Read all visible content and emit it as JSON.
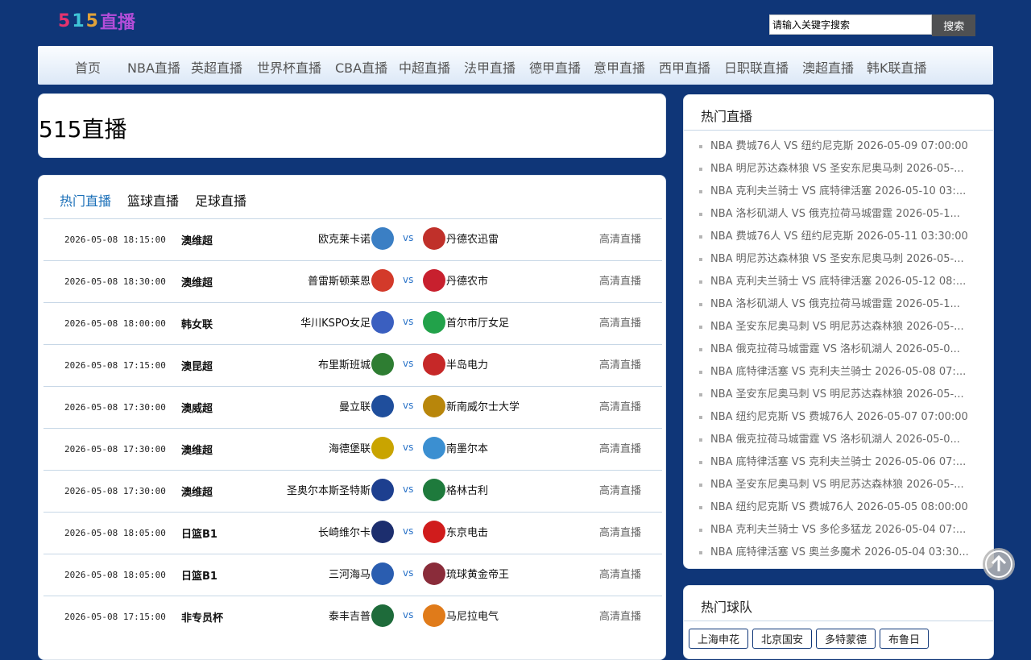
{
  "logo": {
    "text": "515直播"
  },
  "search": {
    "placeholder": "请输入关键字搜索",
    "button": "搜索"
  },
  "nav": [
    "首页",
    "NBA直播",
    "英超直播",
    "世界杯直播",
    "CBA直播",
    "中超直播",
    "法甲直播",
    "德甲直播",
    "意甲直播",
    "西甲直播",
    "日职联直播",
    "澳超直播",
    "韩K联直播"
  ],
  "site_title": "515直播",
  "tabs": [
    "热门直播",
    "篮球直播",
    "足球直播"
  ],
  "matches": [
    {
      "time": "2026-05-08 18:15:00",
      "league": "澳维超",
      "home": "欧克莱卡诺",
      "vs": "vs",
      "away": "丹德农迅雷",
      "watch": "高清直播",
      "home_color": "#3b7fc4",
      "away_color": "#c0302a"
    },
    {
      "time": "2026-05-08 18:30:00",
      "league": "澳维超",
      "home": "普雷斯顿莱恩",
      "vs": "vs",
      "away": "丹德农市",
      "watch": "高清直播",
      "home_color": "#d33a2a",
      "away_color": "#c8202e"
    },
    {
      "time": "2026-05-08 18:00:00",
      "league": "韩女联",
      "home": "华川KSPO女足",
      "vs": "vs",
      "away": "首尔市厅女足",
      "watch": "高清直播",
      "home_color": "#3a5fc0",
      "away_color": "#22a24a"
    },
    {
      "time": "2026-05-08 17:15:00",
      "league": "澳昆超",
      "home": "布里斯班城",
      "vs": "vs",
      "away": "半岛电力",
      "watch": "高清直播",
      "home_color": "#2e7d32",
      "away_color": "#c62828"
    },
    {
      "time": "2026-05-08 17:30:00",
      "league": "澳威超",
      "home": "曼立联",
      "vs": "vs",
      "away": "新南威尔士大学",
      "watch": "高清直播",
      "home_color": "#1f4e9c",
      "away_color": "#b8860b"
    },
    {
      "time": "2026-05-08 17:30:00",
      "league": "澳维超",
      "home": "海德堡联",
      "vs": "vs",
      "away": "南墨尔本",
      "watch": "高清直播",
      "home_color": "#c9a400",
      "away_color": "#3b8fd1"
    },
    {
      "time": "2026-05-08 17:30:00",
      "league": "澳维超",
      "home": "圣奥尔本斯圣特斯",
      "vs": "vs",
      "away": "格林古利",
      "watch": "高清直播",
      "home_color": "#1d3f8f",
      "away_color": "#1e7a3c"
    },
    {
      "time": "2026-05-08 18:05:00",
      "league": "日篮B1",
      "home": "长崎维尔卡",
      "vs": "vs",
      "away": "东京电击",
      "watch": "高清直播",
      "home_color": "#1c2e6e",
      "away_color": "#d01c1c"
    },
    {
      "time": "2026-05-08 18:05:00",
      "league": "日篮B1",
      "home": "三河海马",
      "vs": "vs",
      "away": "琉球黄金帝王",
      "watch": "高清直播",
      "home_color": "#2a5db0",
      "away_color": "#8a2c3a"
    },
    {
      "time": "2026-05-08 17:15:00",
      "league": "非专员杯",
      "home": "泰丰吉普",
      "vs": "vs",
      "away": "马尼拉电气",
      "watch": "高清直播",
      "home_color": "#1e6b3a",
      "away_color": "#e07b1a"
    }
  ],
  "hot_live_title": "热门直播",
  "hot_live": [
    "NBA 费城76人 VS 纽约尼克斯 2026-05-09 07:00:00",
    "NBA 明尼苏达森林狼 VS 圣安东尼奥马刺 2026-05-...",
    "NBA 克利夫兰骑士 VS 底特律活塞 2026-05-10 03:...",
    "NBA 洛杉矶湖人 VS 俄克拉荷马城雷霆 2026-05-1...",
    "NBA 费城76人 VS 纽约尼克斯 2026-05-11 03:30:00",
    "NBA 明尼苏达森林狼 VS 圣安东尼奥马刺 2026-05-...",
    "NBA 克利夫兰骑士 VS 底特律活塞 2026-05-12 08:...",
    "NBA 洛杉矶湖人 VS 俄克拉荷马城雷霆 2026-05-1...",
    "NBA 圣安东尼奥马刺 VS 明尼苏达森林狼 2026-05-...",
    "NBA 俄克拉荷马城雷霆 VS 洛杉矶湖人 2026-05-0...",
    "NBA 底特律活塞 VS 克利夫兰骑士 2026-05-08 07:...",
    "NBA 圣安东尼奥马刺 VS 明尼苏达森林狼 2026-05-...",
    "NBA 纽约尼克斯 VS 费城76人 2026-05-07 07:00:00",
    "NBA 俄克拉荷马城雷霆 VS 洛杉矶湖人 2026-05-0...",
    "NBA 底特律活塞 VS 克利夫兰骑士 2026-05-06 07:...",
    "NBA 圣安东尼奥马刺 VS 明尼苏达森林狼 2026-05-...",
    "NBA 纽约尼克斯 VS 费城76人 2026-05-05 08:00:00",
    "NBA 克利夫兰骑士 VS 多伦多猛龙 2026-05-04 07:...",
    "NBA 底特律活塞 VS 奥兰多魔术 2026-05-04 03:30..."
  ],
  "hot_teams_title": "热门球队",
  "hot_teams": [
    "上海申花",
    "北京国安",
    "多特蒙德",
    "布鲁日"
  ]
}
